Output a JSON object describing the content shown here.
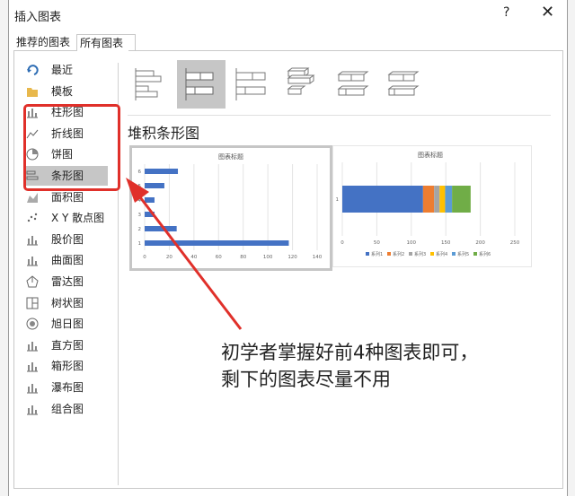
{
  "dialog": {
    "title": "插入图表",
    "help": "?",
    "close": "✕"
  },
  "tabs": [
    "推荐的图表",
    "所有图表"
  ],
  "sidebar": [
    {
      "label": "最近",
      "icon": "recent-icon"
    },
    {
      "label": "模板",
      "icon": "folder-icon"
    },
    {
      "label": "柱形图",
      "icon": "column-chart-icon"
    },
    {
      "label": "折线图",
      "icon": "line-chart-icon"
    },
    {
      "label": "饼图",
      "icon": "pie-chart-icon"
    },
    {
      "label": "条形图",
      "icon": "bar-chart-icon",
      "selected": true
    },
    {
      "label": "面积图",
      "icon": "area-chart-icon"
    },
    {
      "label": "X Y 散点图",
      "icon": "scatter-chart-icon"
    },
    {
      "label": "股价图",
      "icon": "stock-chart-icon"
    },
    {
      "label": "曲面图",
      "icon": "surface-chart-icon"
    },
    {
      "label": "雷达图",
      "icon": "radar-chart-icon"
    },
    {
      "label": "树状图",
      "icon": "treemap-icon"
    },
    {
      "label": "旭日图",
      "icon": "sunburst-icon"
    },
    {
      "label": "直方图",
      "icon": "histogram-icon"
    },
    {
      "label": "箱形图",
      "icon": "boxplot-icon"
    },
    {
      "label": "瀑布图",
      "icon": "waterfall-icon"
    },
    {
      "label": "组合图",
      "icon": "combo-chart-icon"
    }
  ],
  "subtype_heading": "堆积条形图",
  "annotation": {
    "line1": "初学者掌握好前4种图表即可，",
    "line2": "剩下的图表尽量不用",
    "color": "#e0302a"
  },
  "chart_data": [
    {
      "type": "bar",
      "title": "图表标题",
      "orientation": "horizontal",
      "categories": [
        "1",
        "2",
        "3",
        "4",
        "5",
        "6"
      ],
      "values": [
        117,
        26,
        8,
        8,
        16,
        27
      ],
      "xlim": [
        0,
        140
      ],
      "xticks": [
        "0",
        "20",
        "40",
        "60",
        "80",
        "100",
        "120",
        "140"
      ],
      "color": "#4472c4"
    },
    {
      "type": "bar",
      "title": "图表标题",
      "orientation": "horizontal",
      "stacked": true,
      "categories": [
        "1"
      ],
      "series": [
        {
          "name": "系列1",
          "values": [
            117
          ],
          "color": "#4472c4"
        },
        {
          "name": "系列2",
          "values": [
            16
          ],
          "color": "#ed7d31"
        },
        {
          "name": "系列3",
          "values": [
            8
          ],
          "color": "#a5a5a5"
        },
        {
          "name": "系列4",
          "values": [
            8
          ],
          "color": "#ffc000"
        },
        {
          "name": "系列5",
          "values": [
            10
          ],
          "color": "#5b9bd5"
        },
        {
          "name": "系列6",
          "values": [
            27
          ],
          "color": "#70ad47"
        }
      ],
      "xlim": [
        0,
        250
      ],
      "xticks": [
        "0",
        "50",
        "100",
        "150",
        "200",
        "250"
      ]
    }
  ]
}
